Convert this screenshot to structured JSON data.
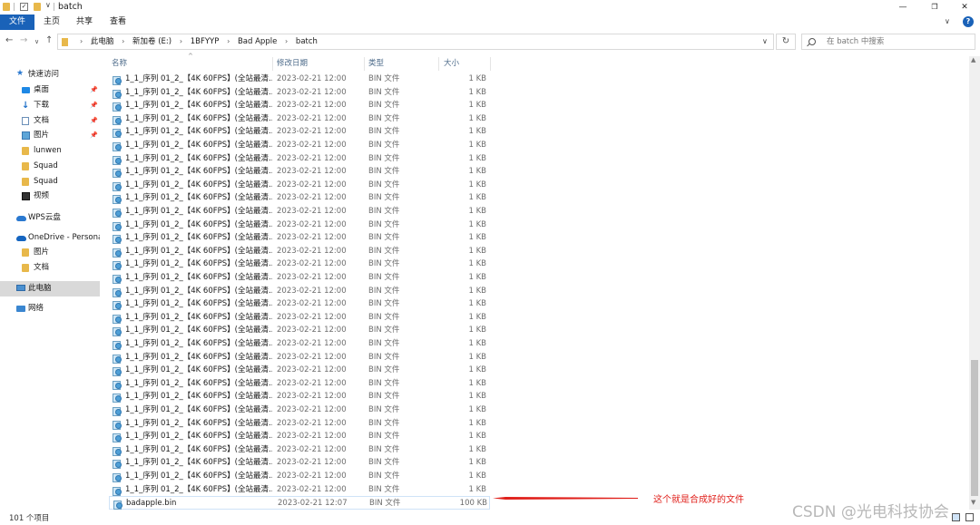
{
  "window": {
    "title": "batch"
  },
  "quick_access": {
    "check_glyph": "✓",
    "dropdown_glyph": "∨"
  },
  "window_controls": {
    "minimize": "—",
    "maximize": "❐",
    "close": "✕"
  },
  "ribbon": {
    "tabs": [
      {
        "label": "文件",
        "active": true
      },
      {
        "label": "主页"
      },
      {
        "label": "共享"
      },
      {
        "label": "查看"
      }
    ],
    "expand_glyph": "∨",
    "help_glyph": "?"
  },
  "nav": {
    "back_glyph": "←",
    "forward_glyph": "→",
    "recent_glyph": "∨",
    "up_glyph": "↑",
    "breadcrumbs": [
      "此电脑",
      "新加卷 (E:)",
      "1BFYYP",
      "Bad Apple",
      "batch"
    ],
    "crumb_sep": "›",
    "address_dropdown_glyph": "∨",
    "refresh_glyph": "↻",
    "search_placeholder": "在 batch 中搜索"
  },
  "sidebar": {
    "pin_glyph": "📌",
    "items": [
      {
        "label": "快速访问",
        "icon": "star-icon",
        "glyph": "★"
      },
      {
        "label": "桌面",
        "icon": "desktop-icon",
        "pinned": true
      },
      {
        "label": "下载",
        "icon": "download-icon",
        "glyph": "↓",
        "pinned": true
      },
      {
        "label": "文档",
        "icon": "document-icon",
        "pinned": true
      },
      {
        "label": "图片",
        "icon": "pictures-icon",
        "pinned": true
      },
      {
        "label": "lunwen",
        "icon": "folder-icon"
      },
      {
        "label": "Squad",
        "icon": "folder-icon"
      },
      {
        "label": "Squad",
        "icon": "folder-icon"
      },
      {
        "label": "视频",
        "icon": "video-icon"
      },
      {
        "label": "WPS云盘",
        "icon": "cloud-icon"
      },
      {
        "label": "OneDrive - Persona",
        "icon": "onedrive-icon"
      },
      {
        "label": "图片",
        "icon": "folder-icon"
      },
      {
        "label": "文档",
        "icon": "folder-icon"
      },
      {
        "label": "此电脑",
        "icon": "computer-icon",
        "selected": true
      },
      {
        "label": "网络",
        "icon": "network-icon"
      }
    ]
  },
  "file_list": {
    "columns": {
      "name": "名称",
      "date": "修改日期",
      "type": "类型",
      "size": "大小"
    },
    "sort_glyph": "^",
    "repeated_file": {
      "name": "1_1_序列 01_2_【4K 60FPS】(全站最清...",
      "date": "2023-02-21 12:00",
      "type": "BIN 文件",
      "size": "1 KB",
      "count": 32
    },
    "last_file": {
      "name": "badapple.bin",
      "date": "2023-02-21 12:07",
      "type": "BIN 文件",
      "size": "100 KB"
    }
  },
  "scrollbar": {
    "up_glyph": "▲",
    "down_glyph": "▼"
  },
  "status": {
    "item_count": "101 个项目"
  },
  "annotation": {
    "text": "这个就是合成好的文件",
    "color": "#e0201b"
  },
  "watermark": {
    "text": "CSDN @光电科技协会"
  },
  "colors": {
    "accent": "#1a62b8",
    "selection": "#d9d9d9",
    "focus_border": "#cfe3f7",
    "folder": "#e8b84a"
  }
}
